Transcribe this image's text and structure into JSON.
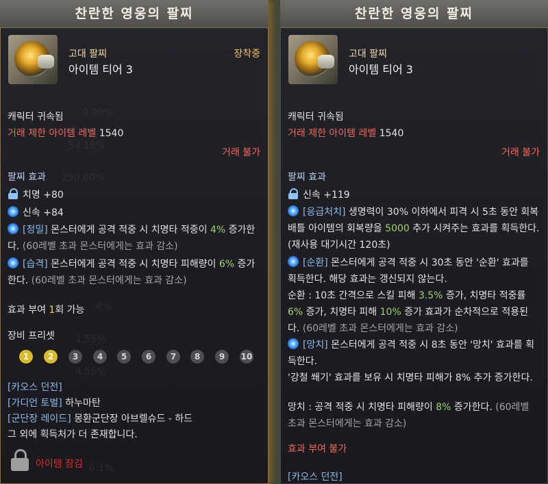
{
  "left": {
    "title": "찬란한 영웅의 팔찌",
    "grade": "고대 팔찌",
    "tier": "아이템 티어 3",
    "equipped": "장착중",
    "bind": "캐릭터 귀속됨",
    "trade_level_label": "거래 제한 아이템 레벨",
    "trade_level_value": "1540",
    "trade_status": "거래 불가",
    "effect_header": "팔찌 효과",
    "stats": [
      {
        "icon": "lock-icon",
        "text": "치명 +80"
      },
      {
        "icon": "spiral-icon",
        "text": "신속 +84"
      }
    ],
    "effects": [
      {
        "tag": "[정밀]",
        "a": " 몬스터에게 공격 적중 시 치명타 적중이 ",
        "val": "4%",
        "b": " 증가한다. ",
        "note": "(60레벨 초과 몬스터에게는 효과 감소)"
      },
      {
        "tag": "[습격]",
        "a": " 몬스터에게 공격 적중 시 치명타 피해량이 ",
        "val": "6%",
        "b": " 증가한다. ",
        "note": "(60레벨 초과 몬스터에게는 효과 감소)"
      }
    ],
    "grant_label": "효과 부여 ",
    "grant_count": "1",
    "grant_suffix": "회 가능",
    "preset_label": "장비 프리셋",
    "presets": [
      "1",
      "2",
      "3",
      "4",
      "5",
      "6",
      "7",
      "8",
      "9",
      "10"
    ],
    "preset_active": 2,
    "sources": [
      "[카오스 던전]",
      "[가디언 토벌]",
      "[군단장 레이드]"
    ],
    "source_details": [
      "",
      " 하누마탄",
      " 몽환군단장 아브렐슈드 - 하드"
    ],
    "more_sources": "그 외에 획득처가 더 존재합니다.",
    "lock_label": "아이템 잠김",
    "ghost_nums": [
      "0.00%",
      "54.18%",
      "250.00%",
      "1.55%",
      "4.55%",
      "4%",
      "6.1%"
    ]
  },
  "right": {
    "title": "찬란한 영웅의 팔찌",
    "grade": "고대 팔찌",
    "tier": "아이템 티어 3",
    "bind": "캐릭터 귀속됨",
    "trade_level_label": "거래 제한 아이템 레벨",
    "trade_level_value": "1540",
    "trade_status": "거래 불가",
    "effect_header": "팔찌 효과",
    "stat": "신속 +119",
    "e1_tag": "[응급처치]",
    "e1_a": " 생명력이 30% 이하에서 피격 시 5초 동안 회복 배틀 아이템의 회복량을 ",
    "e1_val": "5000",
    "e1_b": " 추가 시켜주는 효과를 획득한다. (재사용 대기시간 120초)",
    "e2_tag": "[순환]",
    "e2_a": " 몬스터에게 공격 적중 시 30초 동안 '순환' 효과를 획득한다. 해당 효과는 갱신되지 않는다.",
    "e2_c1": "순환 : 10초 간격으로 스킬 피해 ",
    "e2_v1": "3.5%",
    "e2_c2": " 증가, 치명타 적중률 ",
    "e2_v2": "6%",
    "e2_c3": " 증가, 치명타 피해 ",
    "e2_v3": "10%",
    "e2_c4": " 증가 효과가 순차적으로 적용된다. ",
    "e2_note": "(60레벨 초과 몬스터에게는 효과 감소)",
    "e3_tag": "[망치]",
    "e3_a": " 몬스터에게 공격 적중 시 8초 동안 '망치' 효과를 획득한다.",
    "e3_b": "'강철 쐐기' 효과를 보유 시 치명타 피해가 8% 추가 증가한다.",
    "e3_c": "망치 : 공격 적중 시 치명타 피해량이 ",
    "e3_val": "8%",
    "e3_d": " 증가한다. ",
    "e3_note": "(60레벨 초과 몬스터에게는 효과 감소)",
    "grant": "효과 부여 불가",
    "source": "[카오스 던전]"
  }
}
